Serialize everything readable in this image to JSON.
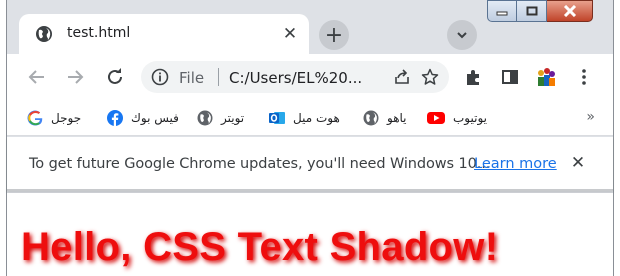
{
  "tab": {
    "title": "test.html",
    "close_glyph": "✕",
    "favicon": "globe-icon"
  },
  "new_tab_glyph": "+",
  "toolbar": {
    "omnibox": {
      "scheme_label": "File",
      "url": "C:/Users/EL%20..."
    }
  },
  "bookmarks": {
    "items": [
      {
        "label": "يوتيوب",
        "icon": "youtube-icon"
      },
      {
        "label": "ياهو",
        "icon": "globe-icon"
      },
      {
        "label": "هوت ميل",
        "icon": "outlook-icon"
      },
      {
        "label": "تويتر",
        "icon": "globe-icon"
      },
      {
        "label": "فيس بوك",
        "icon": "facebook-icon"
      },
      {
        "label": "جوجل",
        "icon": "google-icon"
      }
    ],
    "more_glyph": "»"
  },
  "infobar": {
    "message": "To get future Google Chrome updates, you'll need Windows 10...",
    "link": "Learn more",
    "close_glyph": "✕"
  },
  "page": {
    "heading": "Hello, CSS Text Shadow!"
  },
  "colors": {
    "heading": "#ee0e0e",
    "link": "#1a73e8",
    "tabstrip": "#dee1e6",
    "youtube": "#ff0000",
    "facebook": "#1877f2",
    "outlook": "#0a64c8"
  }
}
